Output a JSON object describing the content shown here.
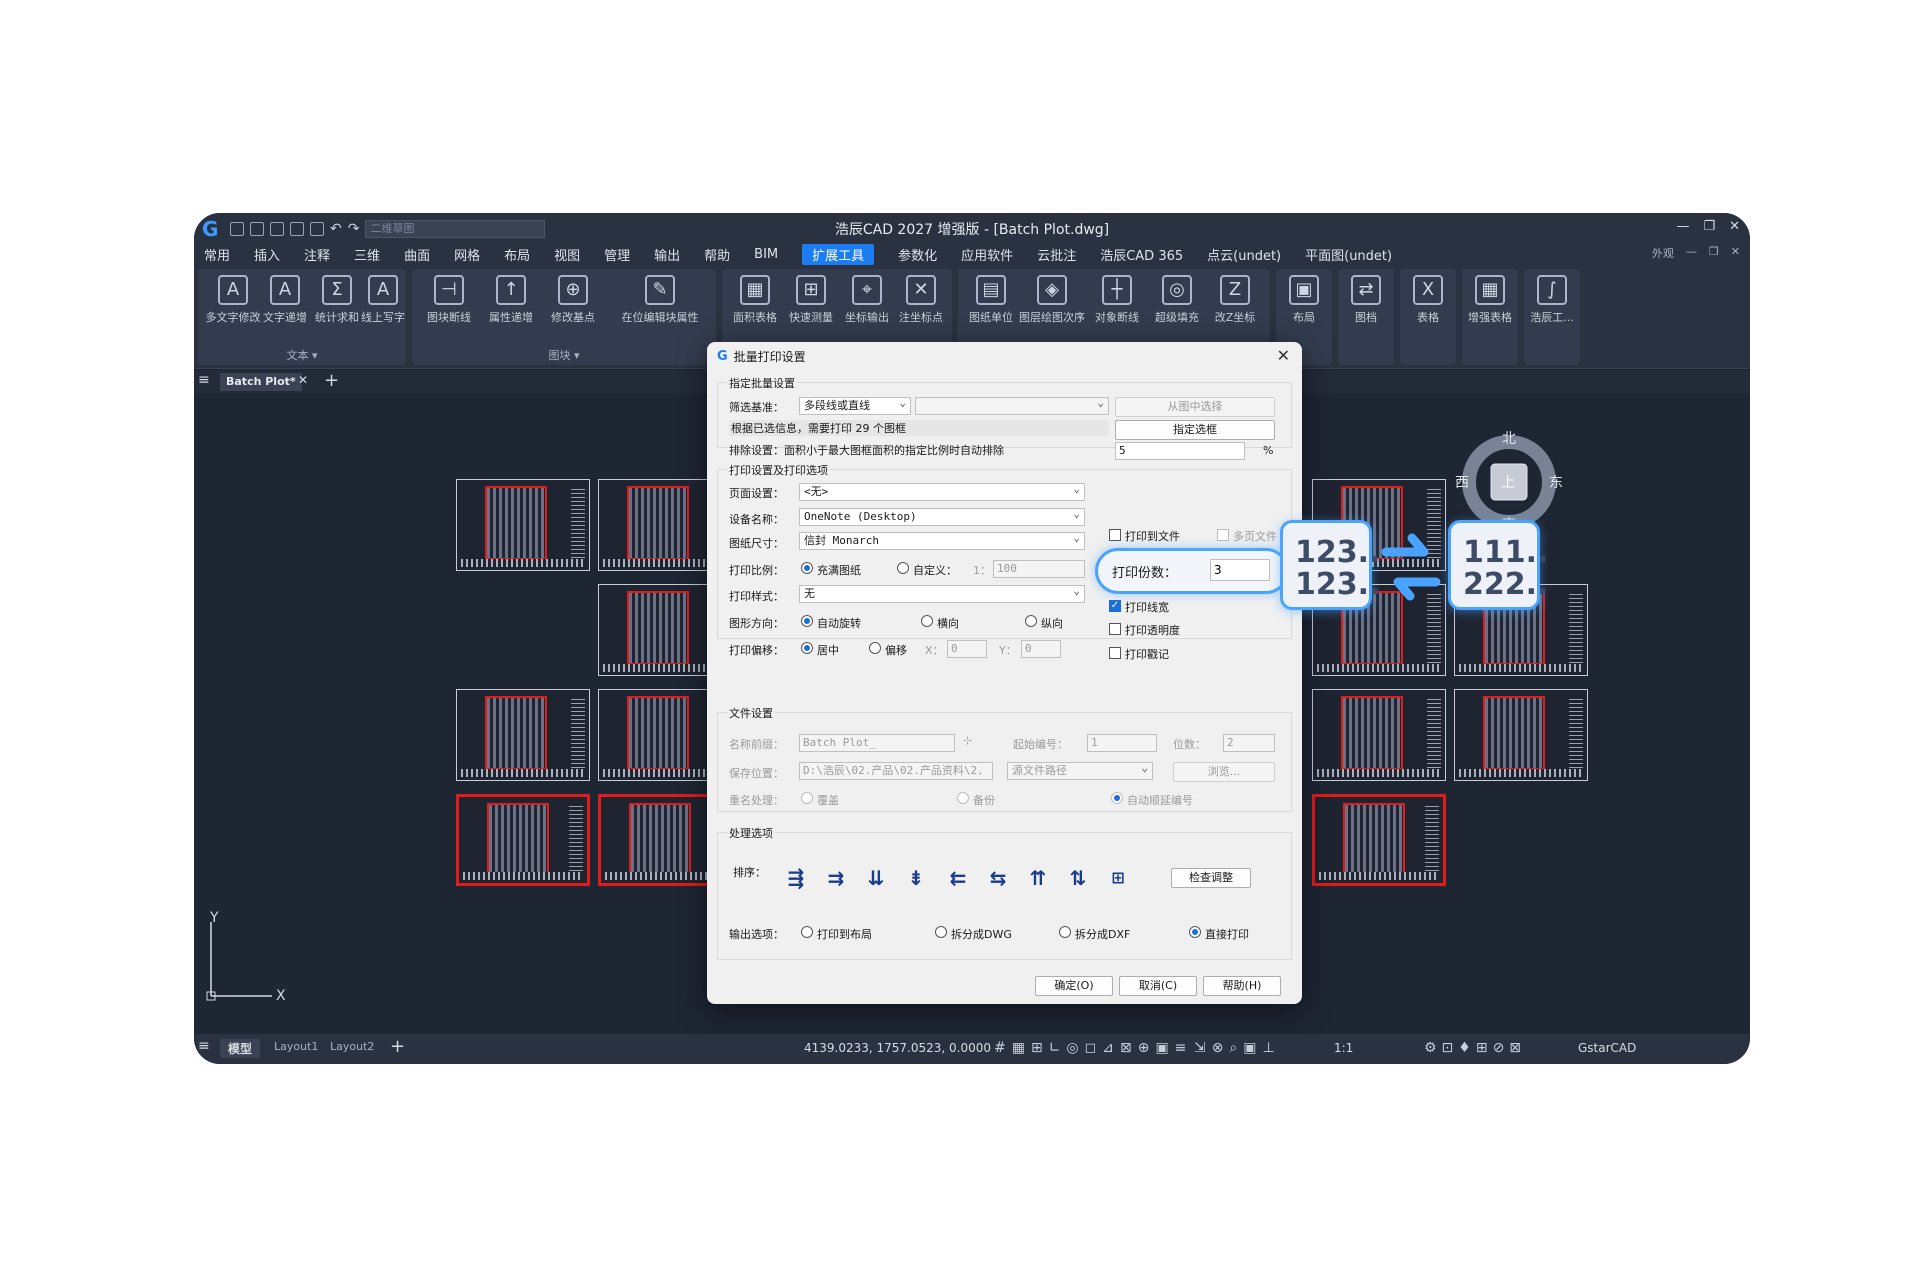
{
  "app": {
    "title": "浩辰CAD 2027 增强版 - [Batch Plot.dwg]",
    "workspace": "二维草图",
    "look": "外观"
  },
  "menu": [
    "常用",
    "插入",
    "注释",
    "三维",
    "曲面",
    "网格",
    "布局",
    "视图",
    "管理",
    "输出",
    "帮助",
    "BIM",
    "扩展工具",
    "参数化",
    "应用软件",
    "云批注",
    "浩辰CAD 365",
    "点云(undet)",
    "平面图(undet)"
  ],
  "menu_active": "扩展工具",
  "ribbon": {
    "text_panel": {
      "label": "文本 ▾",
      "buttons": [
        "多文字修改",
        "文字递增",
        "统计求和",
        "线上写字"
      ]
    },
    "block_panel": {
      "label": "图块 ▾",
      "buttons": [
        "图块断线",
        "属性递增",
        "修改基点",
        "在位编辑块属性"
      ]
    },
    "measure_panel": {
      "buttons": [
        "面积表格",
        "快速测量",
        "坐标输出",
        "注坐标点"
      ]
    },
    "drawing_panel": {
      "buttons": [
        "图纸单位",
        "图层绘图次序",
        "对象断线",
        "超级填充",
        "改Z坐标"
      ]
    },
    "big_buttons": [
      "布局",
      "图档",
      "表格",
      "增强表格",
      "浩辰工..."
    ]
  },
  "doc_tab": "Batch Plot*",
  "layout_tabs": [
    "模型",
    "Layout1",
    "Layout2"
  ],
  "coords": "4139.0233, 1757.0523, 0.0000",
  "zoom": "1:1",
  "brand": "GstarCAD",
  "compass": {
    "n": "北",
    "s": "南",
    "e": "东",
    "w": "西",
    "center": "上"
  },
  "axis": {
    "x": "X",
    "y": "Y"
  },
  "dialog": {
    "title": "批量打印设置",
    "batch": {
      "group": "指定批量设置",
      "filter_label": "筛选基准：",
      "filter_value": "多段线或直线",
      "pick_button": "从图中选择",
      "info": "根据已选信息，需要打印 29 个图框",
      "frame_button": "指定选框",
      "exclude_label": "排除设置：面积小于最大图框面积的指定比例时自动排除",
      "exclude_value": "5",
      "exclude_unit": "%"
    },
    "print": {
      "group": "打印设置及打印选项",
      "page_label": "页面设置：",
      "page_value": "<无>",
      "device_label": "设备名称：",
      "device_value": "OneNote (Desktop)",
      "paper_label": "图纸尺寸：",
      "paper_value": "信封 Monarch",
      "scale_label": "打印比例：",
      "scale_fit": "充满图纸",
      "scale_custom": "自定义：",
      "scale_one": "1：",
      "scale_value": "100",
      "style_label": "打印样式：",
      "style_value": "无",
      "orient_label": "图形方向：",
      "orient_auto": "自动旋转",
      "orient_land": "横向",
      "orient_port": "纵向",
      "offset_label": "打印偏移：",
      "offset_center": "居中",
      "offset_off": "偏移",
      "x_label": "X：",
      "x_value": "0",
      "y_label": "Y：",
      "y_value": "0",
      "to_file": "打印到文件",
      "multi_page": "多页文件",
      "copies_label": "打印份数：",
      "copies_value": "3",
      "lineweight": "打印线宽",
      "transparency": "打印透明度",
      "stamp": "打印戳记"
    },
    "file": {
      "group": "文件设置",
      "prefix_label": "名称前缀：",
      "prefix_value": "Batch Plot_",
      "start_label": "起始编号：",
      "start_value": "1",
      "digits_label": "位数：",
      "digits_value": "2",
      "save_label": "保存位置：",
      "save_value": "D:\\浩辰\\02.产品\\02.产品资料\\2.",
      "source_value": "源文件路径",
      "browse": "浏览...",
      "rename_label": "重名处理：",
      "overwrite": "覆盖",
      "backup": "备份",
      "auto_number": "自动顺延编号"
    },
    "process": {
      "group": "处理选项",
      "sort_label": "排序：",
      "check_button": "检查调整",
      "output_label": "输出选项：",
      "out_layout": "打印到布局",
      "out_dwg": "拆分成DWG",
      "out_dxf": "拆分成DXF",
      "out_direct": "直接打印"
    },
    "ok": "确定(O)",
    "cancel": "取消(C)",
    "help": "帮助(H)"
  },
  "overlay": {
    "left_lines": [
      "123..",
      "123.."
    ],
    "right_lines": [
      "111..",
      "222.."
    ]
  },
  "colors": {
    "accent": "#1b7cf4",
    "frame_red": "#e21b1b",
    "bg_dark": "#1e2533",
    "highlight": "#4aa3ff"
  }
}
